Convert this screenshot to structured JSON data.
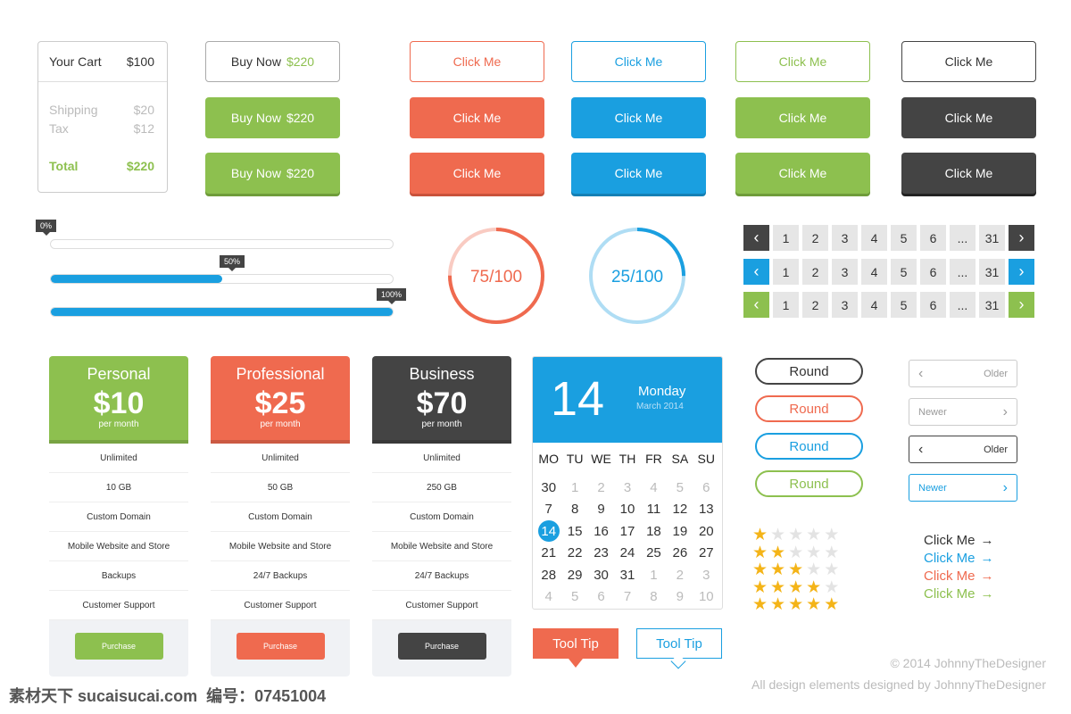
{
  "colors": {
    "green": "#8dc04f",
    "orange": "#ef6a4f",
    "blue": "#1a9fe0",
    "dark": "#444444"
  },
  "cart": {
    "title": "Your Cart",
    "total_top": "$100",
    "rows": [
      {
        "label": "Shipping",
        "value": "$20"
      },
      {
        "label": "Tax",
        "value": "$12"
      }
    ],
    "total_label": "Total",
    "total_value": "$220"
  },
  "buy_now": {
    "label": "Buy Now",
    "price": "$220"
  },
  "click_label": "Click Me",
  "progress": [
    {
      "label": "0%",
      "value": 0
    },
    {
      "label": "50%",
      "value": 50
    },
    {
      "label": "100%",
      "value": 100
    }
  ],
  "circles": [
    {
      "label": "75/100",
      "value": 75,
      "color": "#ef6a4f"
    },
    {
      "label": "25/100",
      "value": 25,
      "color": "#1a9fe0"
    }
  ],
  "pagination": {
    "items": [
      "1",
      "2",
      "3",
      "4",
      "5",
      "6",
      "...",
      "31"
    ],
    "prev_icon": "chevron-left-icon",
    "next_icon": "chevron-right-icon"
  },
  "plans": [
    {
      "name": "Personal",
      "price": "$10",
      "period": "per month",
      "features": [
        "Unlimited",
        "10 GB",
        "Custom Domain",
        "Mobile Website and Store",
        "Backups",
        "Customer Support"
      ],
      "button": "Purchase",
      "color": "#8dc04f"
    },
    {
      "name": "Professional",
      "price": "$25",
      "period": "per month",
      "features": [
        "Unlimited",
        "50 GB",
        "Custom Domain",
        "Mobile Website and Store",
        "24/7 Backups",
        "Customer Support"
      ],
      "button": "Purchase",
      "color": "#ef6a4f"
    },
    {
      "name": "Business",
      "price": "$70",
      "period": "per month",
      "features": [
        "Unlimited",
        "250 GB",
        "Custom Domain",
        "Mobile Website and Store",
        "24/7 Backups",
        "Customer Support"
      ],
      "button": "Purchase",
      "color": "#444444"
    }
  ],
  "calendar": {
    "day": "14",
    "weekday": "Monday",
    "month": "March 2014",
    "weekdays": [
      "MO",
      "TU",
      "WE",
      "TH",
      "FR",
      "SA",
      "SU"
    ],
    "weeks": [
      [
        "30",
        "1",
        "2",
        "3",
        "4",
        "5",
        "6"
      ],
      [
        "7",
        "8",
        "9",
        "10",
        "11",
        "12",
        "13"
      ],
      [
        "14",
        "15",
        "16",
        "17",
        "18",
        "19",
        "20"
      ],
      [
        "21",
        "22",
        "23",
        "24",
        "25",
        "26",
        "27"
      ],
      [
        "28",
        "29",
        "30",
        "31",
        "1",
        "2",
        "3"
      ],
      [
        "4",
        "5",
        "6",
        "7",
        "8",
        "9",
        "10"
      ]
    ],
    "selected": "14"
  },
  "tooltips": [
    "Tool Tip",
    "Tool Tip"
  ],
  "round_label": "Round",
  "pager": [
    {
      "label": "Older",
      "dir": "prev"
    },
    {
      "label": "Newer",
      "dir": "next"
    },
    {
      "label": "Older",
      "dir": "prev"
    },
    {
      "label": "Newer",
      "dir": "next"
    }
  ],
  "ratings": [
    1,
    2,
    3,
    4,
    5
  ],
  "links": [
    {
      "label": "Click Me",
      "color": "#333333"
    },
    {
      "label": "Click Me",
      "color": "#1a9fe0"
    },
    {
      "label": "Click Me",
      "color": "#ef6a4f"
    },
    {
      "label": "Click Me",
      "color": "#8dc04f"
    }
  ],
  "footer": {
    "copyright": "© 2014 JohnnyTheDesigner",
    "credit": "All design elements designed by JohnnyTheDesigner"
  },
  "watermark": "素材天下 sucaisucai.com  编号：07451004"
}
